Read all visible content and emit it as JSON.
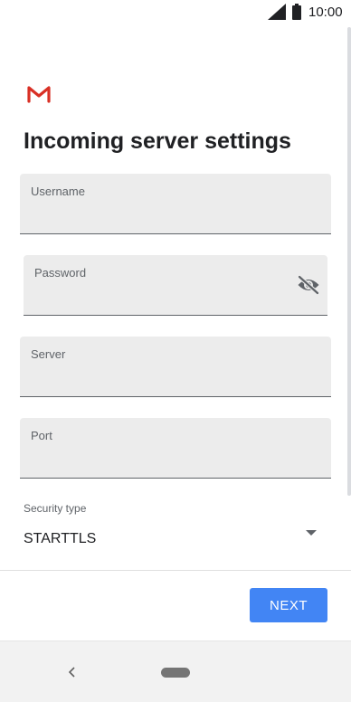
{
  "status_bar": {
    "time": "10:00",
    "signal_icon": "cellular-signal-icon",
    "battery_icon": "battery-full-icon"
  },
  "app": {
    "logo_icon": "gmail-logo-icon",
    "brand_color": "#d93025"
  },
  "page": {
    "title": "Incoming server settings"
  },
  "form": {
    "username": {
      "label": "Username",
      "value": ""
    },
    "password": {
      "label": "Password",
      "value": "",
      "visibility_icon": "visibility-off-icon"
    },
    "server": {
      "label": "Server",
      "value": ""
    },
    "port": {
      "label": "Port",
      "value": ""
    },
    "security_type": {
      "label": "Security type",
      "value": "STARTTLS",
      "dropdown_icon": "arrow-drop-down-icon"
    }
  },
  "actions": {
    "next_label": "NEXT",
    "next_color": "#4285f4"
  },
  "nav_bar": {
    "back_icon": "back-chevron-icon",
    "home_icon": "home-pill-icon"
  }
}
